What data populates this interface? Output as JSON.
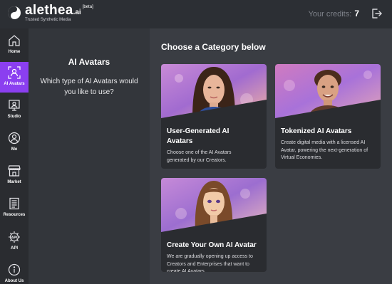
{
  "header": {
    "brand_name": "alethea",
    "brand_suffix": ".ai",
    "beta_label": "[beta]",
    "tagline": "Trusted Synthetic Media",
    "credits_label": "Your credits:",
    "credits_value": "7",
    "logout_icon": "logout-icon"
  },
  "sidebar": {
    "items": [
      {
        "label": "Home",
        "icon": "home-icon",
        "active": false
      },
      {
        "label": "AI Avatars",
        "icon": "avatar-scan-icon",
        "active": true
      },
      {
        "label": "Studio",
        "icon": "studio-icon",
        "active": false
      },
      {
        "label": "Me",
        "icon": "user-icon",
        "active": false
      },
      {
        "label": "Market",
        "icon": "market-icon",
        "active": false
      },
      {
        "label": "Resources",
        "icon": "document-icon",
        "active": false
      },
      {
        "label": "API",
        "icon": "api-icon",
        "active": false
      },
      {
        "label": "About Us",
        "icon": "info-icon",
        "active": false
      }
    ]
  },
  "left_panel": {
    "title": "AI Avatars",
    "question": "Which type of AI Avatars would you like to use?"
  },
  "main": {
    "section_title": "Choose a Category below",
    "cards": [
      {
        "title": "User-Generated AI Avatars",
        "description": "Choose one of the AI Avatars generated by our Creators."
      },
      {
        "title": "Tokenized AI Avatars",
        "description": "Create digital media with a licensed AI Avatar, powering the next-generation of Virtual Economies."
      },
      {
        "title": "Create Your Own AI Avatar",
        "description": "We are gradually opening up access to Creators and Enterprises that want to create AI Avatars"
      }
    ]
  },
  "colors": {
    "accent": "#8b3ff0",
    "header_bg": "#2c2f34",
    "sidebar_bg": "#2a2c30",
    "panel_bg": "#33363b",
    "main_bg": "#3a3d43",
    "card_bg": "#2a2c30"
  }
}
